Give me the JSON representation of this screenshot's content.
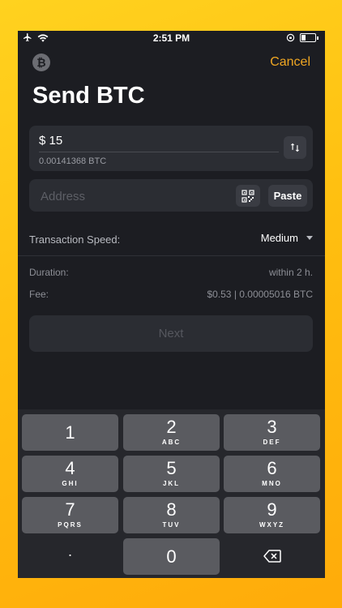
{
  "status_bar": {
    "time": "2:51 PM"
  },
  "header": {
    "coin_symbol": "₿",
    "cancel_label": "Cancel",
    "title": "Send BTC"
  },
  "amount": {
    "value": "$ 15",
    "btc_equivalent": "0.00141368 BTC"
  },
  "address": {
    "placeholder": "Address",
    "paste_label": "Paste"
  },
  "speed": {
    "label": "Transaction Speed:",
    "value": "Medium"
  },
  "info": {
    "duration_label": "Duration:",
    "duration_value": "within 2 h.",
    "fee_label": "Fee:",
    "fee_value": "$0.53 | 0.00005016 BTC"
  },
  "next_label": "Next",
  "keypad": {
    "k1": {
      "digit": "1",
      "letters": ""
    },
    "k2": {
      "digit": "2",
      "letters": "ABC"
    },
    "k3": {
      "digit": "3",
      "letters": "DEF"
    },
    "k4": {
      "digit": "4",
      "letters": "GHI"
    },
    "k5": {
      "digit": "5",
      "letters": "JKL"
    },
    "k6": {
      "digit": "6",
      "letters": "MNO"
    },
    "k7": {
      "digit": "7",
      "letters": "PQRS"
    },
    "k8": {
      "digit": "8",
      "letters": "TUV"
    },
    "k9": {
      "digit": "9",
      "letters": "WXYZ"
    },
    "dot": ".",
    "k0": {
      "digit": "0"
    }
  },
  "colors": {
    "accent": "#f0a722",
    "background": "#1c1d22",
    "card": "#2b2d33"
  }
}
